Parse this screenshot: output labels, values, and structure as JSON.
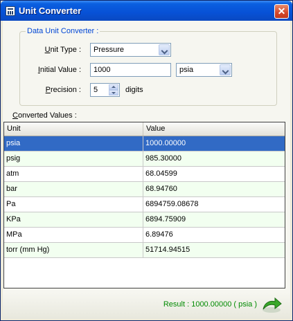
{
  "window": {
    "title": "Unit Converter"
  },
  "form": {
    "group_title": "Data Unit Converter :",
    "unit_type": {
      "label_key": "U",
      "label_rest": "nit Type :",
      "value": "Pressure"
    },
    "initial_value": {
      "label_key": "I",
      "label_rest": "nitial Value :",
      "value": "1000",
      "unit": "psia"
    },
    "precision": {
      "label_key": "P",
      "label_rest": "recision :",
      "value": "5",
      "suffix": "digits"
    }
  },
  "converted": {
    "label_key": "C",
    "label_rest": "onverted Values :",
    "columns": [
      "Unit",
      "Value"
    ],
    "rows": [
      {
        "unit": "psia",
        "value": "1000.00000"
      },
      {
        "unit": "psig",
        "value": "985.30000"
      },
      {
        "unit": "atm",
        "value": "68.04599"
      },
      {
        "unit": "bar",
        "value": "68.94760"
      },
      {
        "unit": "Pa",
        "value": "6894759.08678"
      },
      {
        "unit": "KPa",
        "value": "6894.75909"
      },
      {
        "unit": "MPa",
        "value": "6.89476"
      },
      {
        "unit": "torr (mm Hg)",
        "value": "51714.94515"
      }
    ]
  },
  "status": {
    "result_text": "Result : 1000.00000  ( psia )"
  },
  "colors": {
    "accent": "#316ac5",
    "result": "#008a00",
    "group_title": "#0046d5"
  },
  "icons": {
    "window": "calculator-icon",
    "close": "close-icon",
    "result": "green-arrow-icon"
  }
}
